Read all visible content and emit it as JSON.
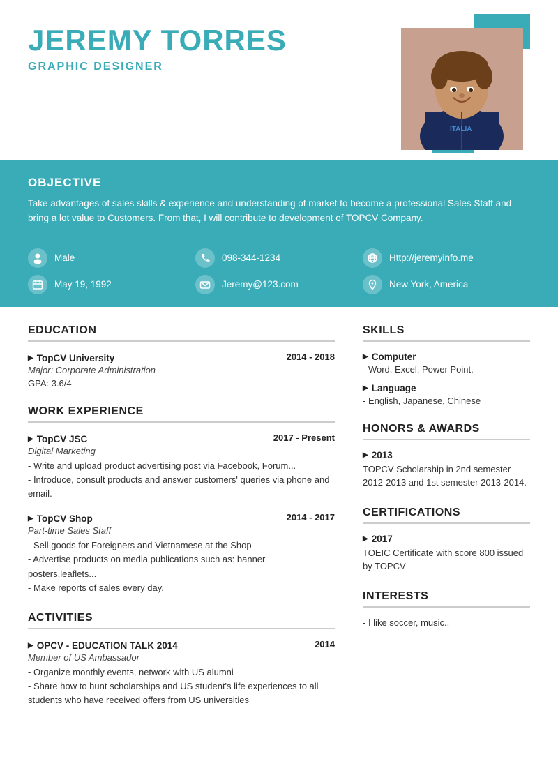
{
  "header": {
    "name": "JEREMY TORRES",
    "title": "GRAPHIC DESIGNER",
    "photo_alt": "Jeremy Torres photo"
  },
  "objective": {
    "section_title": "OBJECTIVE",
    "text": "Take advantages of sales skills & experience and understanding of market to become a professional Sales Staff and bring a lot value to Customers. From that, I will contribute to development of TOPCV Company."
  },
  "info": {
    "gender": "Male",
    "phone": "098-344-1234",
    "website": "Http://jeremyinfo.me",
    "dob": "May 19, 1992",
    "email": "Jeremy@123.com",
    "location": "New York, America"
  },
  "education": {
    "section_title": "EDUCATION",
    "entries": [
      {
        "school": "TopCV University",
        "dates": "2014 - 2018",
        "major": "Major: Corporate Administration",
        "gpa": "GPA: 3.6/4"
      }
    ]
  },
  "work_experience": {
    "section_title": "WORK EXPERIENCE",
    "entries": [
      {
        "company": "TopCV JSC",
        "dates": "2017 - Present",
        "subtitle": "Digital Marketing",
        "details": "- Write and upload product advertising post via Facebook, Forum...\n- Introduce, consult products and answer customers' queries via phone and email."
      },
      {
        "company": "TopCV Shop",
        "dates": "2014 - 2017",
        "subtitle": "Part-time Sales Staff",
        "details": "- Sell goods for Foreigners and Vietnamese at the Shop\n- Advertise products on media publications such as: banner, posters,leaflets...\n- Make reports of sales every day."
      }
    ]
  },
  "activities": {
    "section_title": "ACTIVITIES",
    "entries": [
      {
        "name": "OPCV - EDUCATION TALK 2014",
        "dates": "2014",
        "subtitle": "Member of US Ambassador",
        "details": "- Organize monthly events, network with US alumni\n- Share how to hunt scholarships and US student's life experiences to all students who have received offers from US universities"
      }
    ]
  },
  "skills": {
    "section_title": "SKILLS",
    "entries": [
      {
        "name": "Computer",
        "detail": "- Word, Excel, Power Point."
      },
      {
        "name": "Language",
        "detail": "- English, Japanese, Chinese"
      }
    ]
  },
  "honors": {
    "section_title": "HONORS & AWARDS",
    "entries": [
      {
        "year": "2013",
        "text": "TOPCV Scholarship in 2nd semester 2012-2013 and 1st semester 2013-2014."
      }
    ]
  },
  "certifications": {
    "section_title": "CERTIFICATIONS",
    "entries": [
      {
        "year": "2017",
        "text": "TOEIC Certificate with score 800 issued by TOPCV"
      }
    ]
  },
  "interests": {
    "section_title": "INTERESTS",
    "text": "- I like soccer, music.."
  },
  "icons": {
    "person": "👤",
    "phone": "📞",
    "globe": "🌐",
    "calendar": "📅",
    "email": "✉",
    "location": "📍"
  }
}
